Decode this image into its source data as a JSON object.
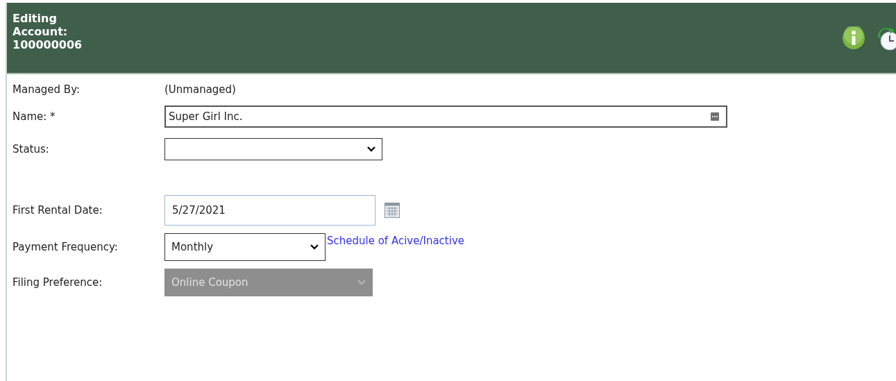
{
  "header": {
    "title_lines": [
      "Editing",
      "Account:",
      "100000006"
    ]
  },
  "fields": [
    {
      "kind": "text",
      "label": "Managed By:",
      "value": "(Unmanaged)"
    },
    {
      "kind": "input",
      "label": "Name: *",
      "value": "Super Girl Inc."
    },
    {
      "kind": "select",
      "label": "Status:",
      "disabled": false
    },
    {
      "kind": "spacer"
    },
    {
      "kind": "date",
      "label": "First Rental Date:",
      "value": "5/27/2021"
    },
    {
      "kind": "select",
      "label": "Payment Frequency:",
      "value": "Monthly",
      "disabled": false,
      "link": "Schedule of Acive/Inactive"
    },
    {
      "kind": "select",
      "label": "Filing Preference:",
      "value": "Online Coupon",
      "disabled": true
    }
  ]
}
